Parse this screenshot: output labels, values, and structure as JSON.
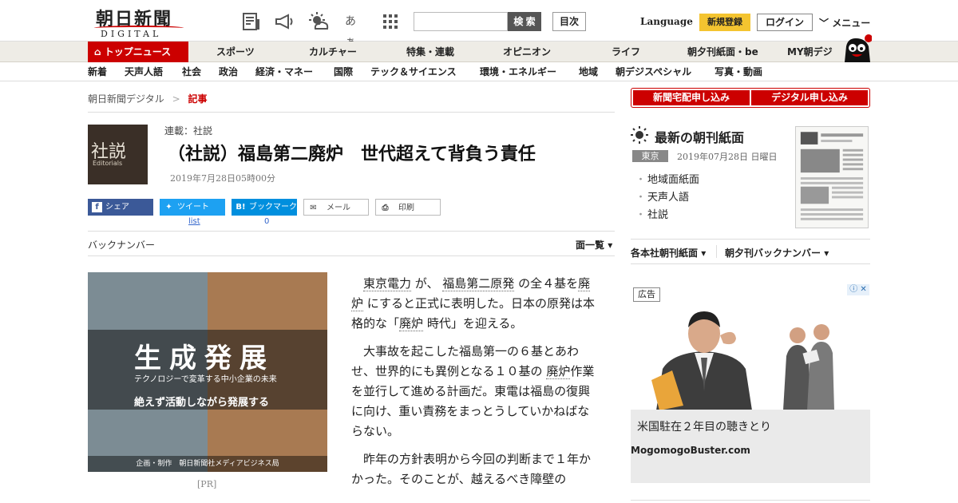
{
  "header": {
    "logo_main": "朝日新聞",
    "logo_sub": "DIGITAL",
    "search_button": "検 索",
    "search_value": "",
    "toc_button": "目次",
    "language_link": "Language",
    "register_button": "新規登録",
    "login_button": "ログイン",
    "menu_button": "メニュー",
    "font_size_icon_text": "あぁ"
  },
  "nav_primary": [
    "トップニュース",
    "スポーツ",
    "カルチャー",
    "特集・連載",
    "オピニオン",
    "ライフ",
    "朝夕刊紙面・be",
    "MY朝デジ"
  ],
  "nav_secondary": [
    "新着",
    "天声人語",
    "社会",
    "政治",
    "経済・マネー",
    "国際",
    "テック＆サイエンス",
    "環境・エネルギー",
    "地域",
    "朝デジスペシャル",
    "写真・動画"
  ],
  "breadcrumb": {
    "home": "朝日新聞デジタル",
    "separator": ">",
    "current": "記事"
  },
  "article": {
    "thumb_title": "社説",
    "thumb_sub": "Editorials",
    "series": "連載：社説",
    "title": "（社説）福島第二廃炉　世代超えて背負う責任",
    "date": "2019年7月28日05時00分",
    "share": {
      "facebook": "シェア",
      "twitter": "ツイート",
      "hatena": "ブックマーク",
      "mail": "メール",
      "print": "印刷",
      "twitter_count": "list",
      "hatena_count": "0"
    },
    "back_number": "バックナンバー",
    "page_menu": "面一覧",
    "pr_label": "[PR]",
    "paragraphs": {
      "p1_kw1": "東京電力",
      "p1_t1": "が、",
      "p1_kw2": "福島第二原発",
      "p1_t2": "の全４基を",
      "p1_kw3": "廃炉",
      "p1_t3": "にすると正式に表明した。日本の原発は本格的な「",
      "p1_kw4": "廃炉",
      "p1_t4": "時代」を迎える。",
      "p2_t1": "大事故を起こした福島第一の６基とあわせ、世界的にも異例となる１０基の",
      "p2_kw1": "廃炉",
      "p2_t2": "作業を並行して進める計画だ。東電は福島の復興に向け、重い責務をまっとうしていかねばならない。",
      "p3": "昨年の方針表明から今回の判断まで１年かかった。そのことが、越えるべき障壁の"
    }
  },
  "promo": {
    "big_text": "生成発展",
    "sub1": "テクノロジーで変革する中小企業の未来",
    "sub2": "絶えず活動しながら発展する",
    "footer": "企画・制作　朝日新聞社メディアビジネス局"
  },
  "sidebar": {
    "subscribe_paper": "新聞宅配申し込み",
    "subscribe_digital": "デジタル申し込み",
    "paper_heading": "最新の朝刊紙面",
    "region": "東京",
    "paper_date": "2019年07月28日 日曜日",
    "links": [
      "地域面紙面",
      "天声人語",
      "社説"
    ],
    "menu_main": "各本社朝刊紙面",
    "menu_back": "朝夕刊バックナンバー"
  },
  "ad": {
    "label": "広告",
    "title": "米国駐在２年目の聴きとり",
    "source": "MogomogoBuster.com"
  },
  "colors": {
    "brand_red": "#cc0000",
    "register_yellow": "#f4c430",
    "facebook": "#3b5998",
    "twitter": "#1da1f2",
    "hatena": "#008fde"
  }
}
